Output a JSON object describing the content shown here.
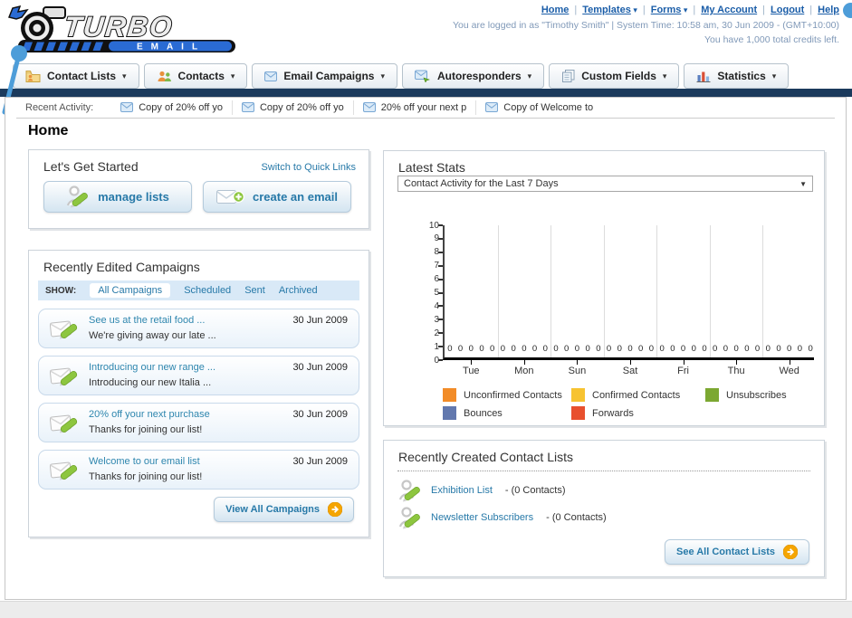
{
  "brand": {
    "name": "TURBO",
    "sub": "EMAIL"
  },
  "header": {
    "nav": [
      {
        "label": "Home",
        "dropdown": false
      },
      {
        "label": "Templates",
        "dropdown": true
      },
      {
        "label": "Forms",
        "dropdown": true
      },
      {
        "label": "My Account",
        "dropdown": false
      },
      {
        "label": "Logout",
        "dropdown": false
      },
      {
        "label": "Help",
        "dropdown": false
      }
    ],
    "login_line1": "You are logged in as \"Timothy Smith\" | System Time: 10:58 am, 30 Jun 2009 - (GMT+10:00)",
    "login_line2": "You have 1,000 total credits left."
  },
  "tabs": [
    {
      "label": "Contact Lists",
      "icon": "folder-contact-icon"
    },
    {
      "label": "Contacts",
      "icon": "people-icon"
    },
    {
      "label": "Email Campaigns",
      "icon": "envelope-icon"
    },
    {
      "label": "Autoresponders",
      "icon": "envelope-arrow-icon"
    },
    {
      "label": "Custom Fields",
      "icon": "pages-icon"
    },
    {
      "label": "Statistics",
      "icon": "bar-chart-icon"
    }
  ],
  "recent_activity": {
    "label": "Recent Activity:",
    "items": [
      {
        "label": "Copy of 20% off yo",
        "icon": "envelope-icon"
      },
      {
        "label": "Copy of 20% off yo",
        "icon": "envelope-icon"
      },
      {
        "label": "20% off your next p",
        "icon": "envelope-icon"
      },
      {
        "label": "Copy of Welcome to",
        "icon": "envelope-icon"
      }
    ]
  },
  "page_title": "Home",
  "get_started": {
    "title": "Let's Get Started",
    "switch_link": "Switch to Quick Links",
    "buttons": [
      {
        "label": "manage lists",
        "icon": "person-pencil-icon"
      },
      {
        "label": "create an email",
        "icon": "envelope-plus-icon"
      }
    ]
  },
  "campaigns_panel": {
    "title": "Recently Edited Campaigns",
    "show_label": "SHOW:",
    "filters": [
      {
        "label": "All Campaigns",
        "active": true
      },
      {
        "label": "Scheduled",
        "active": false
      },
      {
        "label": "Sent",
        "active": false
      },
      {
        "label": "Archived",
        "active": false
      }
    ],
    "items": [
      {
        "title": "See us at the retail food ...",
        "subtitle": "We're giving away our late ...",
        "date": "30 Jun 2009",
        "icon": "envelope-pencil-icon"
      },
      {
        "title": "Introducing our new range ...",
        "subtitle": "Introducing our new Italia ...",
        "date": "30 Jun 2009",
        "icon": "envelope-pencil-icon"
      },
      {
        "title": "20% off your next purchase",
        "subtitle": "Thanks for joining our list!",
        "date": "30 Jun 2009",
        "icon": "envelope-pencil-icon"
      },
      {
        "title": "Welcome to our email list",
        "subtitle": "Thanks for joining our list!",
        "date": "30 Jun 2009",
        "icon": "envelope-pencil-icon"
      }
    ],
    "view_all_label": "View All Campaigns"
  },
  "stats_panel": {
    "title": "Latest Stats",
    "selector_value": "Contact Activity for the Last 7 Days"
  },
  "chart_data": {
    "type": "bar",
    "title": "Contact Activity for the Last 7 Days",
    "categories": [
      "Tue",
      "Mon",
      "Sun",
      "Sat",
      "Fri",
      "Thu",
      "Wed"
    ],
    "series": [
      {
        "name": "Unconfirmed Contacts",
        "color": "#F28C28",
        "values": [
          0,
          0,
          0,
          0,
          0,
          0,
          0
        ]
      },
      {
        "name": "Confirmed Contacts",
        "color": "#F7C331",
        "values": [
          0,
          0,
          0,
          0,
          0,
          0,
          0
        ]
      },
      {
        "name": "Unsubscribes",
        "color": "#7CA832",
        "values": [
          0,
          0,
          0,
          0,
          0,
          0,
          0
        ]
      },
      {
        "name": "Bounces",
        "color": "#6278AE",
        "values": [
          0,
          0,
          0,
          0,
          0,
          0,
          0
        ]
      },
      {
        "name": "Forwards",
        "color": "#E8502E",
        "values": [
          0,
          0,
          0,
          0,
          0,
          0,
          0
        ]
      }
    ],
    "xlabel": "",
    "ylabel": "",
    "ylim": [
      0,
      10
    ],
    "ytick_step": 1,
    "grid": "vertical-separators-only",
    "legend_position": "bottom",
    "value_labels_shown": true
  },
  "contact_lists_panel": {
    "title": "Recently Created Contact Lists",
    "items": [
      {
        "name": "Exhibition List",
        "detail": "- (0 Contacts)",
        "icon": "person-pencil-icon"
      },
      {
        "name": "Newsletter Subscribers",
        "detail": "- (0 Contacts)",
        "icon": "person-pencil-icon"
      }
    ],
    "see_all_label": "See All Contact Lists"
  },
  "colors": {
    "navy_bar": "#1b3a5c",
    "accent_dot_blue": "#4d9dd9",
    "top_link_blue": "#1a5da8",
    "teal_link": "#2779a8",
    "show_bar_bg": "#d9e9f7",
    "button_arrow_orange": "#f5a500",
    "logo_blue": "#2a6bd4"
  }
}
